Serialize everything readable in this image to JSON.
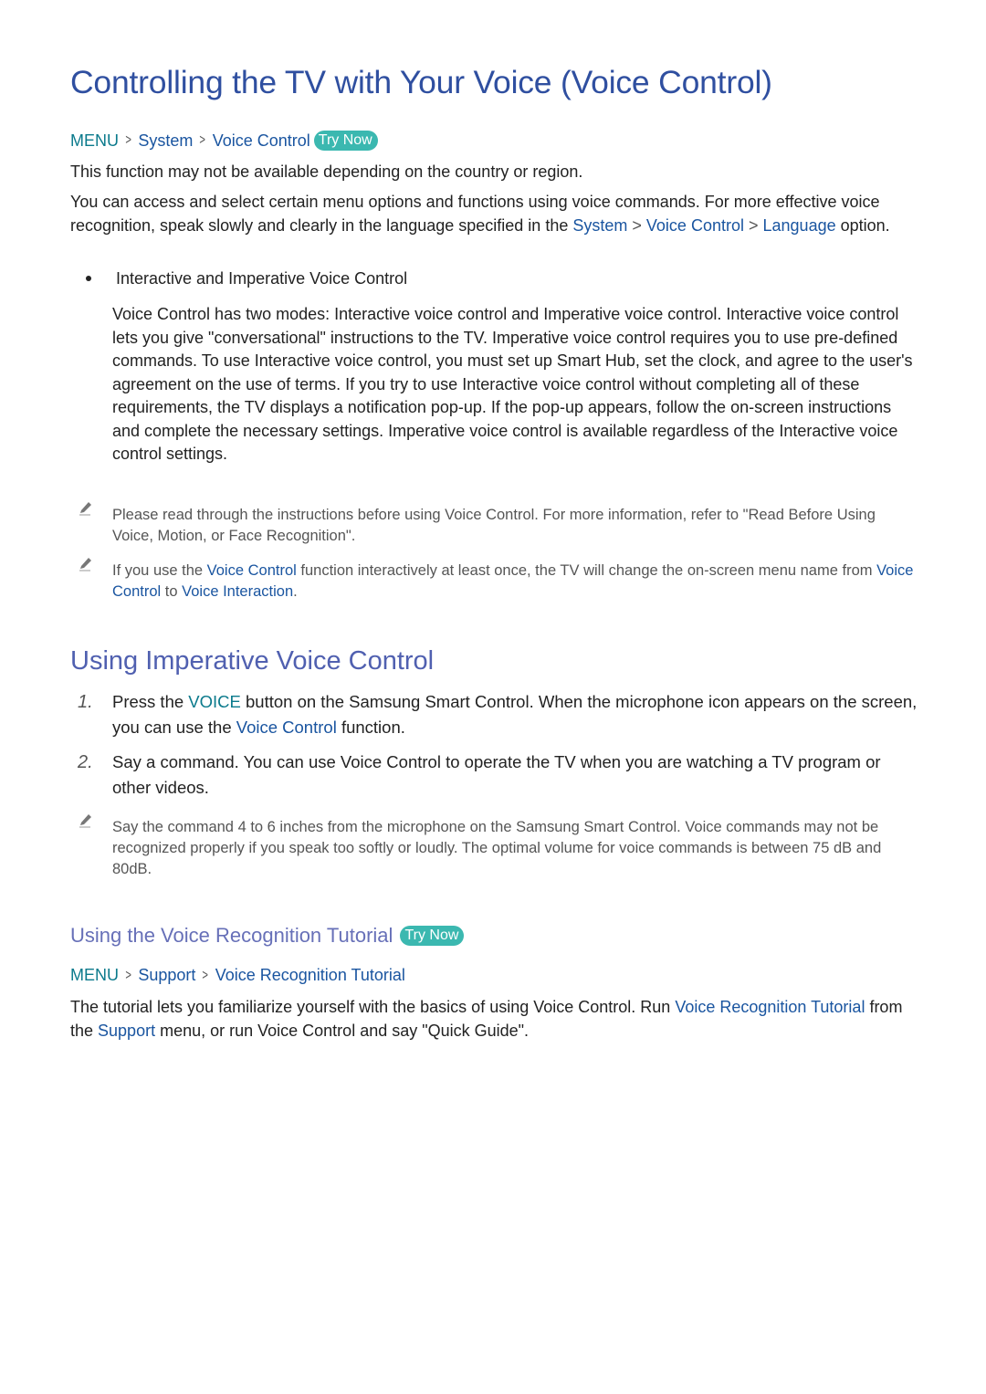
{
  "title": "Controlling the TV with Your Voice (Voice Control)",
  "path1": {
    "menu": "MENU",
    "items": [
      "System",
      "Voice Control"
    ],
    "try_now": "Try Now"
  },
  "availability": "This function may not be available depending on the country or region.",
  "intro": {
    "t1": "You can access and select certain menu options and functions using voice commands. For more effective voice recognition, speak slowly and clearly in the language specified in the ",
    "l1": "System",
    "l2": "Voice Control",
    "l3": "Language",
    "t2": " option."
  },
  "bullet": {
    "title": "Interactive and Imperative Voice Control",
    "body": "Voice Control has two modes: Interactive voice control and Imperative voice control. Interactive voice control lets you give \"conversational\" instructions to the TV. Imperative voice control requires you to use pre-defined commands. To use Interactive voice control, you must set up Smart Hub, set the clock, and agree to the user's agreement on the use of terms. If you try to use Interactive voice control without completing all of these requirements, the TV displays a notification pop-up. If the pop-up appears, follow the on-screen instructions and complete the necessary settings. Imperative voice control is available regardless of the Interactive voice control settings."
  },
  "notes": {
    "n1": "Please read through the instructions before using Voice Control. For more information, refer to \"Read Before Using Voice, Motion, or Face Recognition\".",
    "n2": {
      "t1": "If you use the ",
      "l1": "Voice Control",
      "t2": " function interactively at least once, the TV will change the on-screen menu name from ",
      "l2": "Voice Control",
      "t3": " to ",
      "l3": "Voice Interaction",
      "t4": "."
    },
    "n3": "Say the command 4 to 6 inches from the microphone on the Samsung Smart Control. Voice commands may not be recognized properly if you speak too softly or loudly. The optimal volume for voice commands is between 75 dB and 80dB."
  },
  "section2": {
    "title": "Using Imperative Voice Control",
    "steps": [
      {
        "num": "1.",
        "t1": "Press the ",
        "l1": "VOICE",
        "t2": " button on the Samsung Smart Control. When the microphone icon appears on the screen, you can use the ",
        "l2": "Voice Control",
        "t3": " function."
      },
      {
        "num": "2.",
        "text": "Say a command. You can use Voice Control to operate the TV when you are watching a TV program or other videos."
      }
    ]
  },
  "section3": {
    "title": "Using the Voice Recognition Tutorial",
    "try_now": "Try Now",
    "path": {
      "menu": "MENU",
      "items": [
        "Support",
        "Voice Recognition Tutorial"
      ]
    },
    "body": {
      "t1": "The tutorial lets you familiarize yourself with the basics of using Voice Control. Run ",
      "l1": "Voice Recognition Tutorial",
      "t2": " from the ",
      "l2": "Support",
      "t3": " menu, or run Voice Control and say \"Quick Guide\"."
    }
  },
  "separator_glyph": ">"
}
